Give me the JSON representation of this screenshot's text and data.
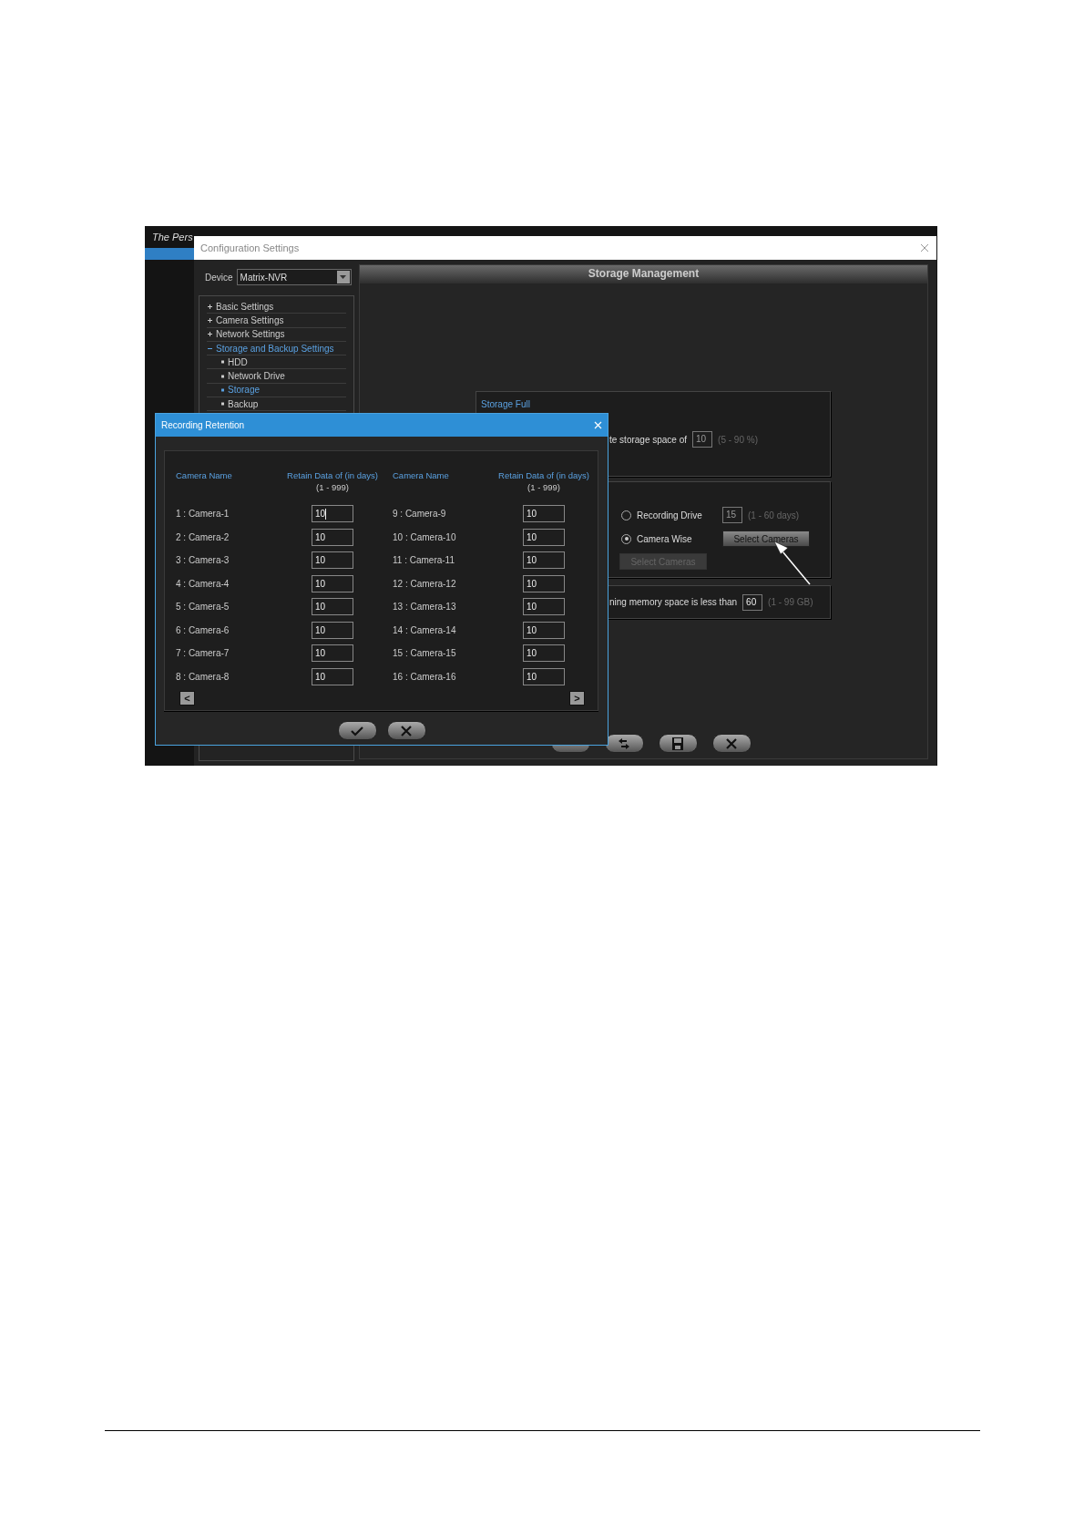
{
  "background_app": {
    "tagline": "The Pers"
  },
  "config_window": {
    "title": "Configuration Settings",
    "device": {
      "label": "Device",
      "value": "Matrix-NVR"
    },
    "tree": [
      {
        "label": "Basic Settings",
        "expanded": false
      },
      {
        "label": "Camera Settings",
        "expanded": false
      },
      {
        "label": "Network Settings",
        "expanded": false
      },
      {
        "label": "Storage and Backup Settings",
        "expanded": true,
        "children": [
          {
            "label": "HDD",
            "selected": false
          },
          {
            "label": "Network Drive",
            "selected": false
          },
          {
            "label": "Storage",
            "selected": true
          },
          {
            "label": "Backup",
            "selected": false
          }
        ]
      }
    ],
    "panel": {
      "title": "Storage Management",
      "storage_full": {
        "title": "Storage Full",
        "text": "te storage space of",
        "value": "10",
        "range": "(5 - 90 %)"
      },
      "retention": {
        "options": [
          {
            "kind": "field",
            "label": "Recording Drive",
            "selected": false,
            "value": "15",
            "range": "(1 - 60 days)"
          },
          {
            "kind": "button",
            "label": "Camera Wise",
            "selected": true,
            "button": {
              "label": "Select Cameras",
              "disabled": false
            }
          }
        ],
        "extra_button": {
          "label": "Select Cameras",
          "disabled": true
        }
      },
      "memory": {
        "text": "ning memory space is less than",
        "value": "60",
        "range": "(1 - 99 GB)"
      }
    },
    "toolbar": [
      {
        "kind": "blank"
      },
      {
        "kind": "refresh"
      },
      {
        "kind": "save"
      },
      {
        "kind": "close"
      }
    ]
  },
  "dialog": {
    "title": "Recording Retention",
    "columns": [
      {
        "label": "Camera Name"
      },
      {
        "label": "Retain Data of (in days)",
        "sub": "(1 - 999)"
      },
      {
        "label": "Camera Name"
      },
      {
        "label": "Retain Data of (in days)",
        "sub": "(1 - 999)"
      }
    ],
    "rows": [
      {
        "name": "1 : Camera-1",
        "value": "10",
        "focused": true
      },
      {
        "name": "2 : Camera-2",
        "value": "10",
        "focused": false
      },
      {
        "name": "3 : Camera-3",
        "value": "10",
        "focused": false
      },
      {
        "name": "4 : Camera-4",
        "value": "10",
        "focused": false
      },
      {
        "name": "5 : Camera-5",
        "value": "10",
        "focused": false
      },
      {
        "name": "6 : Camera-6",
        "value": "10",
        "focused": false
      },
      {
        "name": "7 : Camera-7",
        "value": "10",
        "focused": false
      },
      {
        "name": "8 : Camera-8",
        "value": "10",
        "focused": false
      },
      {
        "name": "9 : Camera-9",
        "value": "10",
        "focused": false
      },
      {
        "name": "10 : Camera-10",
        "value": "10",
        "focused": false
      },
      {
        "name": "11 : Camera-11",
        "value": "10",
        "focused": false
      },
      {
        "name": "12 : Camera-12",
        "value": "10",
        "focused": false
      },
      {
        "name": "13 : Camera-13",
        "value": "10",
        "focused": false
      },
      {
        "name": "14 : Camera-14",
        "value": "10",
        "focused": false
      },
      {
        "name": "15 : Camera-15",
        "value": "10",
        "focused": false
      },
      {
        "name": "16 : Camera-16",
        "value": "10",
        "focused": false
      }
    ],
    "pager": [
      "<",
      ">"
    ],
    "buttons": [
      {
        "kind": "ok"
      },
      {
        "kind": "cancel"
      }
    ]
  }
}
